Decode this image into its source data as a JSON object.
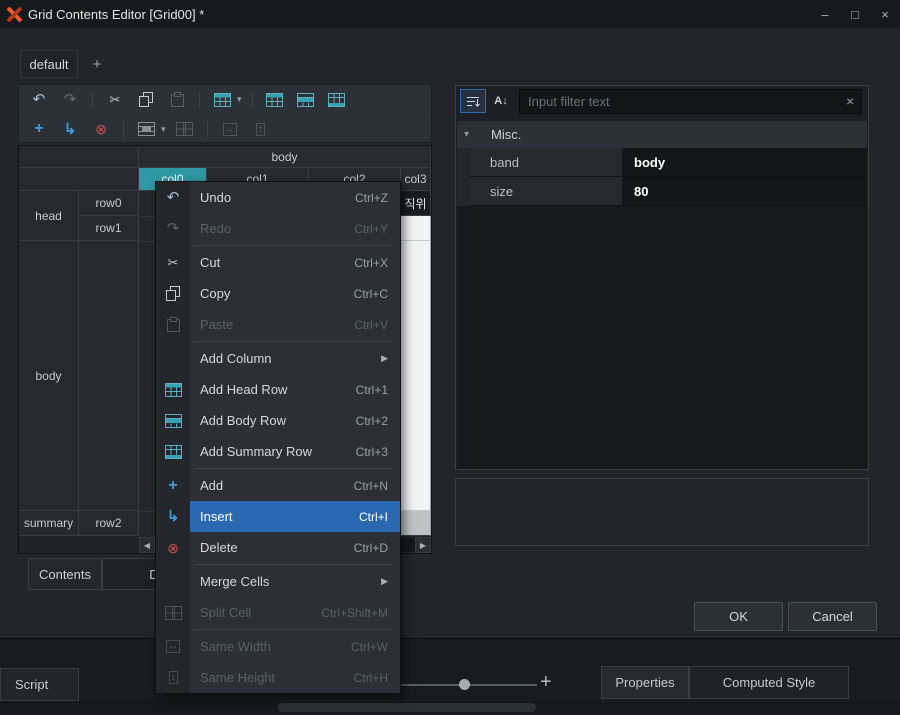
{
  "titlebar": {
    "title": "Grid Contents Editor [Grid00] *"
  },
  "icons": {
    "undo": "↶",
    "redo": "↷",
    "cut": "✂",
    "add": "+",
    "insert": "↳",
    "delete": "⊗",
    "dropdown": "▾",
    "submenu": "▶",
    "collapse_chevron": "▾",
    "sort_alpha": "A↓",
    "scroll_left": "◀",
    "scroll_right": "▶",
    "clear": "×",
    "minimize": "–",
    "maximize": "□",
    "close": "×",
    "same_width": "↔",
    "same_height": "↕",
    "zoom_plus": "+"
  },
  "doc_tabs": {
    "active": "default",
    "add": "+"
  },
  "grid": {
    "top_band": "body",
    "columns": [
      "col0",
      "col1",
      "col2",
      "col3"
    ],
    "selected_column": "col0",
    "bands": {
      "head": "head",
      "body": "body",
      "summary": "summary"
    },
    "rows": [
      "row0",
      "row1",
      "row2"
    ],
    "cell_row0_col3": "직위"
  },
  "editor_tabs": {
    "contents": "Contents",
    "second_partial": "D"
  },
  "context_menu": {
    "items": [
      {
        "label": "Undo",
        "shortcut": "Ctrl+Z",
        "enabled": true
      },
      {
        "label": "Redo",
        "shortcut": "Ctrl+Y",
        "enabled": false
      },
      {
        "label": "Cut",
        "shortcut": "Ctrl+X",
        "enabled": true
      },
      {
        "label": "Copy",
        "shortcut": "Ctrl+C",
        "enabled": true
      },
      {
        "label": "Paste",
        "shortcut": "Ctrl+V",
        "enabled": false
      },
      {
        "label": "Add Column",
        "shortcut": "",
        "submenu": true,
        "enabled": true
      },
      {
        "label": "Add Head Row",
        "shortcut": "Ctrl+1",
        "enabled": true
      },
      {
        "label": "Add Body Row",
        "shortcut": "Ctrl+2",
        "enabled": true
      },
      {
        "label": "Add Summary Row",
        "shortcut": "Ctrl+3",
        "enabled": true
      },
      {
        "label": "Add",
        "shortcut": "Ctrl+N",
        "enabled": true
      },
      {
        "label": "Insert",
        "shortcut": "Ctrl+I",
        "enabled": true,
        "highlighted": true
      },
      {
        "label": "Delete",
        "shortcut": "Ctrl+D",
        "enabled": true
      },
      {
        "label": "Merge Cells",
        "shortcut": "",
        "submenu": true,
        "enabled": true
      },
      {
        "label": "Split Cell",
        "shortcut": "Ctrl+Shift+M",
        "enabled": false
      },
      {
        "label": "Same Width",
        "shortcut": "Ctrl+W",
        "enabled": false
      },
      {
        "label": "Same Height",
        "shortcut": "Ctrl+H",
        "enabled": false
      }
    ]
  },
  "properties_panel": {
    "filter_placeholder": "Input filter text",
    "section": "Misc.",
    "rows": [
      {
        "name": "band",
        "value": "body"
      },
      {
        "name": "size",
        "value": "80"
      }
    ]
  },
  "buttons": {
    "ok": "OK",
    "cancel": "Cancel"
  },
  "ide": {
    "script": "Script",
    "tabs": [
      "Properties",
      "Computed Style"
    ]
  },
  "colors": {
    "accent_blue": "#2d6cb3",
    "selection_teal": "#2f99a5",
    "delete_red": "#d0504a",
    "menu_highlight_blue": "#2a69b2",
    "insert_blue": "#3f9be0"
  }
}
